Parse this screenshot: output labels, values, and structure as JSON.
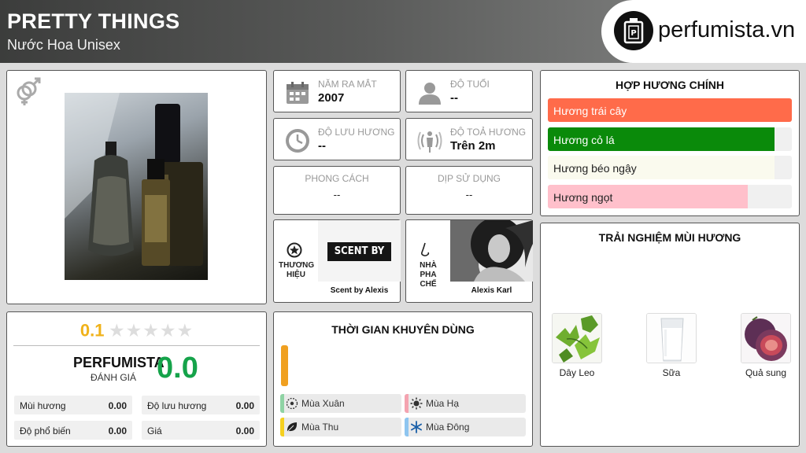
{
  "header": {
    "title": "PRETTY THINGS",
    "subtitle": "Nước Hoa Unisex",
    "logo_text": "perfumista.vn"
  },
  "product": {
    "gender_icon": "unisex-gender-icon"
  },
  "rating": {
    "user_score": "0.1",
    "stars_total": 5,
    "stars_filled": 0,
    "perfumista_label": "PERFUMISTA",
    "perfumista_sub": "ĐÁNH GIÁ",
    "perfumista_score": "0.0",
    "metrics": [
      {
        "label": "Mùi hương",
        "value": "0.00"
      },
      {
        "label": "Độ lưu hương",
        "value": "0.00"
      },
      {
        "label": "Độ phổ biến",
        "value": "0.00"
      },
      {
        "label": "Giá",
        "value": "0.00"
      }
    ]
  },
  "info": {
    "year": {
      "label": "NĂM RA MẮT",
      "value": "2007",
      "icon": "calendar-icon"
    },
    "age": {
      "label": "ĐỘ TUỔI",
      "value": "--",
      "icon": "person-icon"
    },
    "longevity": {
      "label": "ĐỘ LƯU HƯƠNG",
      "value": "--",
      "icon": "clock-icon"
    },
    "sillage": {
      "label": "ĐỘ TOẢ HƯƠNG",
      "value": "Trên 2m",
      "icon": "sillage-icon"
    },
    "style": {
      "label": "PHONG CÁCH",
      "value": "--"
    },
    "occasion": {
      "label": "DỊP SỬ DỤNG",
      "value": "--"
    }
  },
  "brand": {
    "label": "THƯƠNG HIỆU",
    "name": "Scent by Alexis",
    "logo_text": "SCENT BY ALEXIS",
    "icon": "star-badge-icon"
  },
  "perfumer": {
    "label": "NHÀ PHA CHẾ",
    "name": "Alexis Karl",
    "icon": "nose-icon"
  },
  "time": {
    "title": "THỜI GIAN KHUYÊN DÙNG",
    "accent": "#f0a020",
    "seasons": [
      {
        "label": "Mùa Xuân",
        "color": "#8fd3a4",
        "icon": "flower-icon"
      },
      {
        "label": "Mùa Hạ",
        "color": "#f4a3b0",
        "icon": "sun-icon"
      },
      {
        "label": "Mùa Thu",
        "color": "#f5d020",
        "icon": "leaf-icon"
      },
      {
        "label": "Mùa Đông",
        "color": "#8ec5f0",
        "icon": "snowflake-icon"
      }
    ]
  },
  "accords": {
    "title": "HỢP HƯƠNG CHÍNH",
    "items": [
      {
        "label": "Hương trái cây",
        "percent": 100,
        "color": "#ff6b4a",
        "text_color": "#ffffff"
      },
      {
        "label": "Hương cỏ lá",
        "percent": 93,
        "color": "#0a8a0a",
        "text_color": "#ffffff"
      },
      {
        "label": "Hương béo ngậy",
        "percent": 93,
        "color": "#fafaee",
        "text_color": "#222222"
      },
      {
        "label": "Hương ngọt",
        "percent": 82,
        "color": "#ffc0cb",
        "text_color": "#222222"
      }
    ]
  },
  "experience": {
    "title": "TRẢI NGHIỆM MÙI HƯƠNG",
    "notes": [
      {
        "label": "Dây Leo",
        "icon": "vine-leaves-icon"
      },
      {
        "label": "Sữa",
        "icon": "milk-glass-icon"
      },
      {
        "label": "Quả sung",
        "icon": "fig-icon"
      }
    ]
  }
}
